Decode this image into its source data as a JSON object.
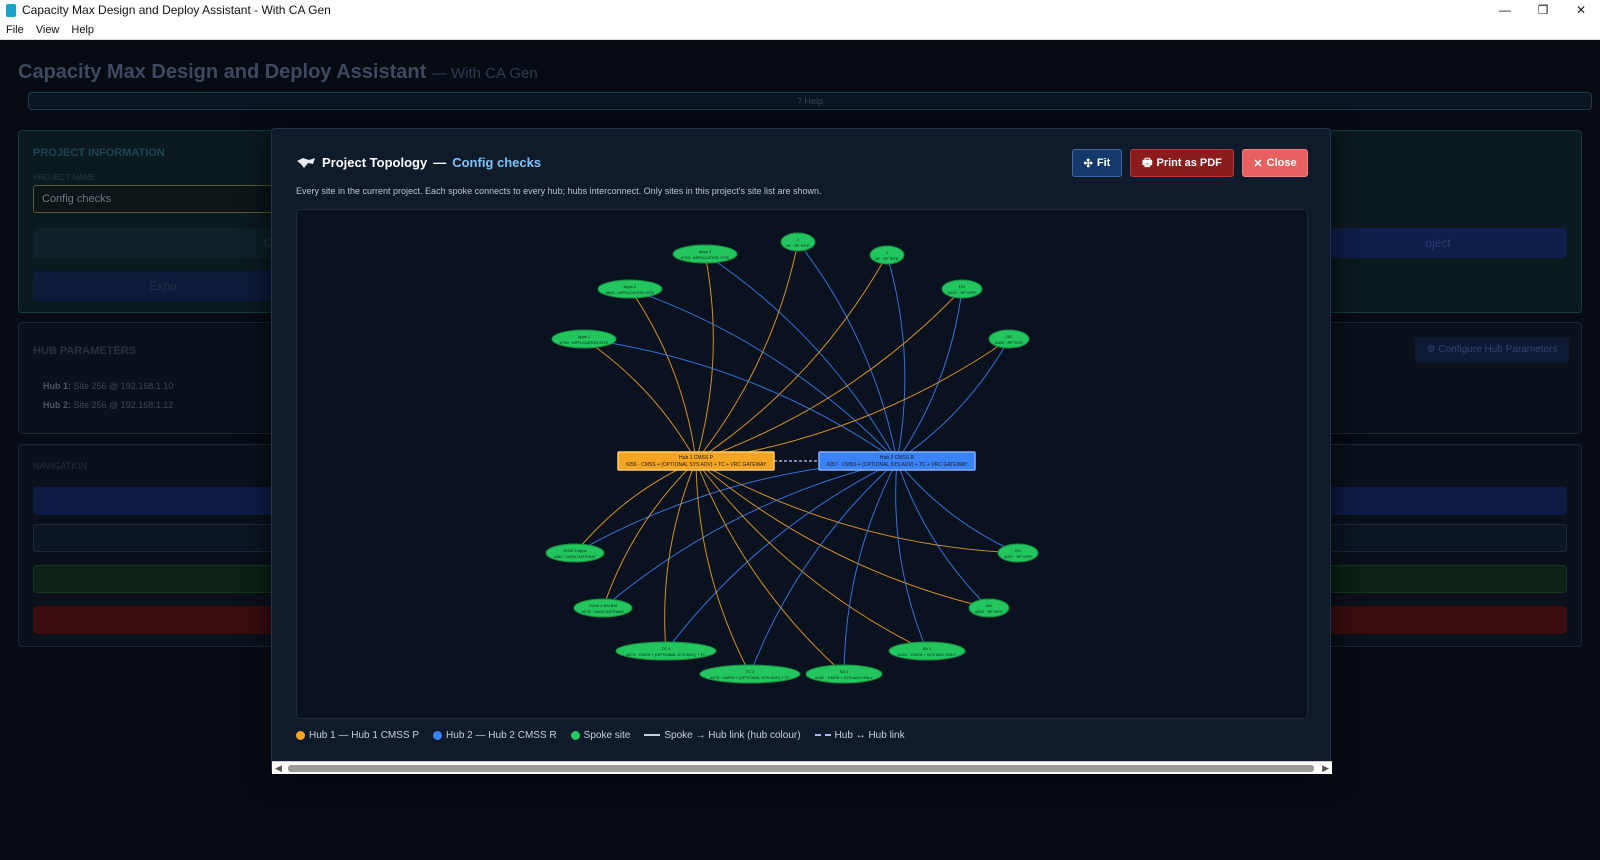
{
  "window": {
    "title": "Capacity Max Design and Deploy Assistant - With CA Gen",
    "controls": [
      "—",
      "❐",
      "✕"
    ]
  },
  "menu": [
    "File",
    "View",
    "Help"
  ],
  "app": {
    "title": "Capacity Max Design and Deploy Assistant",
    "subtitle": "— With CA Gen",
    "help": "? Help"
  },
  "project_info": {
    "title": "PROJECT INFORMATION",
    "name_label": "PROJECT NAME",
    "name_value": "Config checks",
    "open_label": "Ope",
    "export_label": "Expo",
    "right_btn": "oject"
  },
  "hub_params": {
    "title": "HUB PARAMETERS",
    "hub1_label": "Hub 1:",
    "hub1_value": "Site 256 @ 192.168.1.10",
    "hub2_label": "Hub 2:",
    "hub2_value": "Site 256 @ 192.168.1.12",
    "configure": "⚙ Configure Hub Parameters"
  },
  "navigation": {
    "title": "NAVIGATION"
  },
  "modal": {
    "icon": "network-icon",
    "title": "Project Topology",
    "separator": "—",
    "project": "Config checks",
    "fit": "Fit",
    "pdf": "Print as PDF",
    "close": "Close",
    "description": "Every site in the current project. Each spoke connects to every hub; hubs interconnect. Only sites in this project's site list are shown.",
    "colors": {
      "hub1": "#f5a524",
      "hub2": "#3b82f6",
      "spoke": "#22c55e"
    },
    "legend": {
      "hub1": "Hub 1 — Hub 1 CMSS P",
      "hub2": "Hub 2 — Hub 2 CMSS R",
      "spoke": "Spoke site",
      "link": "Spoke → Hub link (hub colour)",
      "hublink": "Hub ↔ Hub link"
    },
    "hubs": [
      {
        "name": "Hub 1 CMSS P",
        "detail": "#256 · CMSS + (OPTIONAL SYS ADV) + TC + VRC GATEWAY"
      },
      {
        "name": "Hub 2 CMSS R",
        "detail": "#257 · CMSS + (OPTIONAL SYS ADV) + TC + VRC GATEWAY"
      }
    ],
    "spokes": [
      {
        "name": "Apps 3",
        "detail": "#799 · APPLICATION SITE"
      },
      {
        "name": "1",
        "detail": "#1 · RF SITE"
      },
      {
        "name": "2",
        "detail": "#2 · RF SITE"
      },
      {
        "name": "Apps 2",
        "detail": "#800 · APPLICATION SITE"
      },
      {
        "name": "101",
        "detail": "#101 · RF SITE"
      },
      {
        "name": "Apps 1",
        "detail": "#790 · APPLICATION SITE"
      },
      {
        "name": "102",
        "detail": "#102 · RF SITE"
      },
      {
        "name": "DGW 2 Apps",
        "detail": "#280 · DATA GATEWAY"
      },
      {
        "name": "201",
        "detail": "#201 · RF SITE"
      },
      {
        "name": "DGW 1 RM BM",
        "detail": "#278 · DATA GATEWAY"
      },
      {
        "name": "202",
        "detail": "#202 · RF SITE"
      },
      {
        "name": "TC 4",
        "detail": "#274 · CMSS + (OPTIONAL SYS ADV) + TC"
      },
      {
        "name": "SA 1",
        "detail": "#251 · CMSS + SYS ADV ONLY"
      },
      {
        "name": "TC 3",
        "detail": "#273 · CMSS + (OPTIONAL SYS ADV) + TC"
      },
      {
        "name": "SA 2",
        "detail": "#252 · CMSS + SYS ADV ONLY"
      }
    ]
  }
}
